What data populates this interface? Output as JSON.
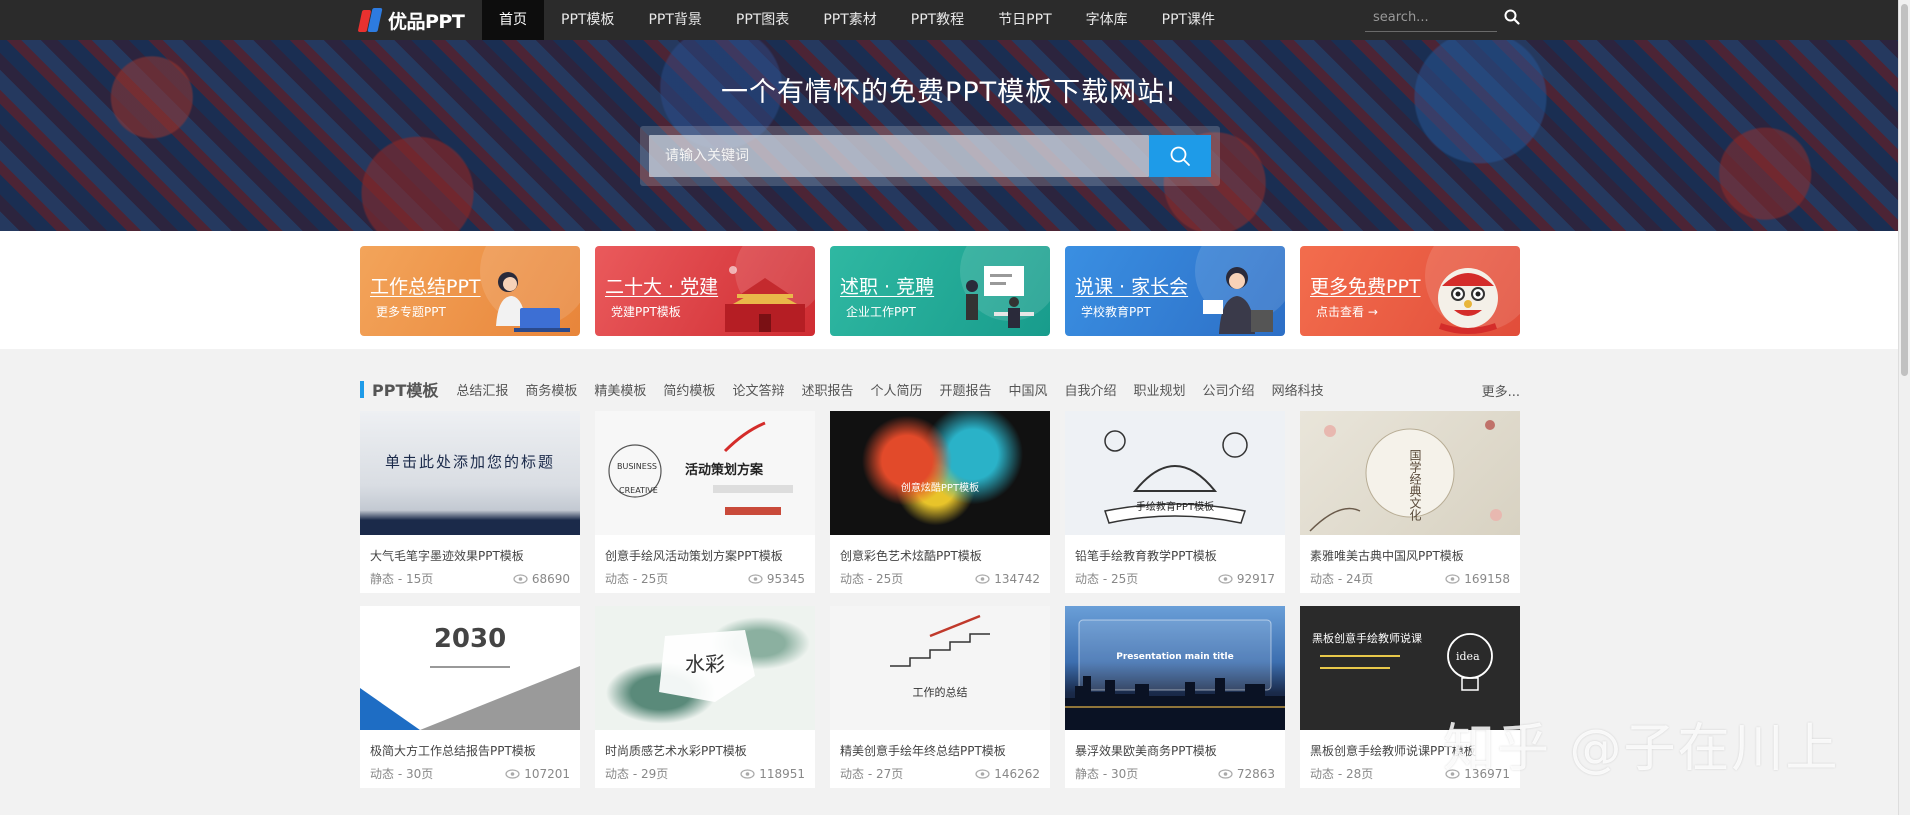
{
  "nav": {
    "logo_text": "优品PPT",
    "items": [
      {
        "label": "首页"
      },
      {
        "label": "PPT模板"
      },
      {
        "label": "PPT背景"
      },
      {
        "label": "PPT图表"
      },
      {
        "label": "PPT素材"
      },
      {
        "label": "PPT教程"
      },
      {
        "label": "节日PPT"
      },
      {
        "label": "字体库"
      },
      {
        "label": "PPT课件"
      }
    ],
    "active_index": 0,
    "search_placeholder": "search..."
  },
  "hero": {
    "title": "一个有情怀的免费PPT模板下载网站!",
    "search_placeholder": "请输入关键词"
  },
  "banners": [
    {
      "title": "工作总结PPT",
      "sub": "更多专题PPT",
      "color": "#ec8d45"
    },
    {
      "title": "二十大 · 党建",
      "sub": "党建PPT模板",
      "color": "#dd3d41"
    },
    {
      "title": "述职 · 竞聘",
      "sub": "企业工作PPT",
      "color": "#22a996"
    },
    {
      "title": "说课 · 家长会",
      "sub": "学校教育PPT",
      "color": "#347fd4"
    },
    {
      "title": "更多免费PPT",
      "sub": "点击查看 →",
      "color": "#e85b41"
    }
  ],
  "section": {
    "title": "PPT模板",
    "tags": [
      "总结汇报",
      "商务模板",
      "精美模板",
      "简约模板",
      "论文答辩",
      "述职报告",
      "个人简历",
      "开题报告",
      "中国风",
      "自我介绍",
      "职业规划",
      "公司介绍",
      "网络科技"
    ],
    "more": "更多..."
  },
  "cards": [
    {
      "title": "大气毛笔字墨迹效果PPT模板",
      "meta": "静态 - 15页",
      "views": "68690",
      "thumb_text": "单击此处添加您的标题"
    },
    {
      "title": "创意手绘风活动策划方案PPT模板",
      "meta": "动态 - 25页",
      "views": "95345",
      "thumb_text": "活动策划方案"
    },
    {
      "title": "创意彩色艺术炫酷PPT模板",
      "meta": "动态 - 25页",
      "views": "134742",
      "thumb_text": "创意炫酷PPT模板"
    },
    {
      "title": "铅笔手绘教育教学PPT模板",
      "meta": "动态 - 25页",
      "views": "92917",
      "thumb_text": "手绘教育PPT模板"
    },
    {
      "title": "素雅唯美古典中国风PPT模板",
      "meta": "动态 - 24页",
      "views": "169158",
      "thumb_text": "国学经典文化"
    },
    {
      "title": "极简大方工作总结报告PPT模板",
      "meta": "动态 - 30页",
      "views": "107201",
      "thumb_text": "2030"
    },
    {
      "title": "时尚质感艺术水彩PPT模板",
      "meta": "动态 - 29页",
      "views": "118951",
      "thumb_text": "水彩"
    },
    {
      "title": "精美创意手绘年终总结PPT模板",
      "meta": "动态 - 27页",
      "views": "146262",
      "thumb_text": "工作的总结"
    },
    {
      "title": "暴浮效果欧美商务PPT模板",
      "meta": "静态 - 30页",
      "views": "72863",
      "thumb_text": "Presentation main title"
    },
    {
      "title": "黑板创意手绘教师说课PPT模板",
      "meta": "动态 - 28页",
      "views": "136971",
      "thumb_text": "黑板创意手绘教师说课"
    }
  ],
  "watermark": "知乎 @子在川上",
  "colors": {
    "accent": "#1e9be8",
    "nav_bg": "#2b2b2b"
  }
}
